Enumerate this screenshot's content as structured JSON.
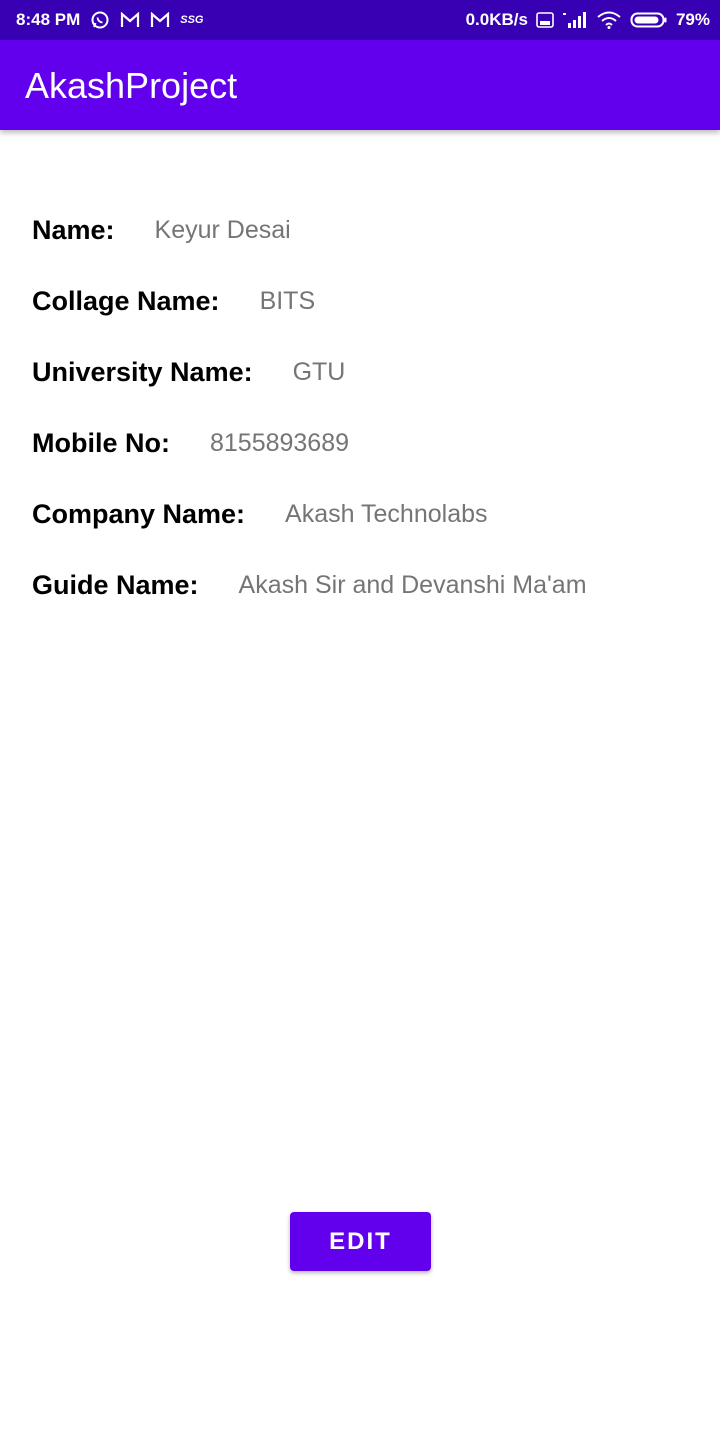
{
  "status_bar": {
    "time": "8:48 PM",
    "small_tag": "SSG",
    "net_speed": "0.0KB/s",
    "battery": "79%",
    "icons": [
      "whatsapp-icon",
      "gmail-icon",
      "gmail-icon",
      "volte-icon",
      "signal-icon",
      "wifi-icon",
      "battery-icon"
    ]
  },
  "app_bar": {
    "title": "AkashProject"
  },
  "details": [
    {
      "label": "Name:",
      "value": "Keyur Desai"
    },
    {
      "label": "Collage Name:",
      "value": "BITS"
    },
    {
      "label": "University Name:",
      "value": "GTU"
    },
    {
      "label": "Mobile No:",
      "value": "8155893689"
    },
    {
      "label": "Company Name:",
      "value": "Akash Technolabs"
    },
    {
      "label": "Guide Name:",
      "value": "Akash Sir and Devanshi Ma'am"
    }
  ],
  "actions": {
    "edit_label": "EDIT"
  },
  "colors": {
    "status_bar": "#3700b3",
    "primary": "#6200ee",
    "label_text": "#000000",
    "value_text": "#757575"
  }
}
